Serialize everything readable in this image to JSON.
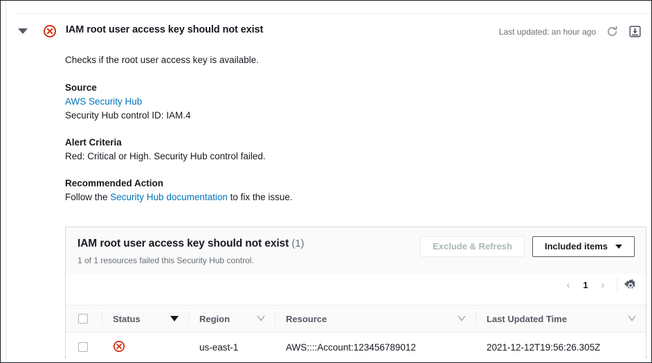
{
  "section": {
    "title": "IAM root user access key should not exist",
    "status_icon": "error-circle-x-icon",
    "collapse_icon": "caret-down-icon",
    "last_updated": "Last updated: an hour ago",
    "refresh_icon": "refresh-icon",
    "download_icon": "download-icon",
    "description": "Checks if the root user access key is available.",
    "blocks": {
      "source_label": "Source",
      "source_link": "AWS Security Hub",
      "source_control_id": "Security Hub control ID: IAM.4",
      "alert_criteria_label": "Alert Criteria",
      "alert_criteria_text": "Red: Critical or High. Security Hub control failed.",
      "recommended_action_label": "Recommended Action",
      "recommended_action_prefix": "Follow the ",
      "recommended_action_link": "Security Hub documentation",
      "recommended_action_suffix": " to fix the issue."
    }
  },
  "card": {
    "title": "IAM root user access key should not exist",
    "count": "(1)",
    "subtitle": "1 of 1 resources failed this Security Hub control.",
    "exclude_refresh_label": "Exclude & Refresh",
    "included_items_label": "Included items",
    "included_items_caret": "caret-down-icon",
    "pagination": {
      "prev_icon": "chevron-left-icon",
      "page": "1",
      "next_icon": "chevron-right-icon",
      "settings_icon": "gear-icon"
    },
    "table": {
      "columns": [
        {
          "label": "Status",
          "sort": "solid"
        },
        {
          "label": "Region",
          "sort": "hollow"
        },
        {
          "label": "Resource",
          "sort": "hollow"
        },
        {
          "label": "Last Updated Time",
          "sort": "hollow"
        }
      ],
      "rows": [
        {
          "status_icon": "error-circle-x-icon",
          "region": "us-east-1",
          "resource": "AWS::::Account:123456789012",
          "last_updated_time": "2021-12-12T19:56:26.305Z"
        }
      ]
    }
  },
  "colors": {
    "error_red": "#d13212",
    "link_blue": "#0073bb",
    "text_dark": "#16191f",
    "text_muted": "#687078",
    "border_light": "#eaeded"
  }
}
